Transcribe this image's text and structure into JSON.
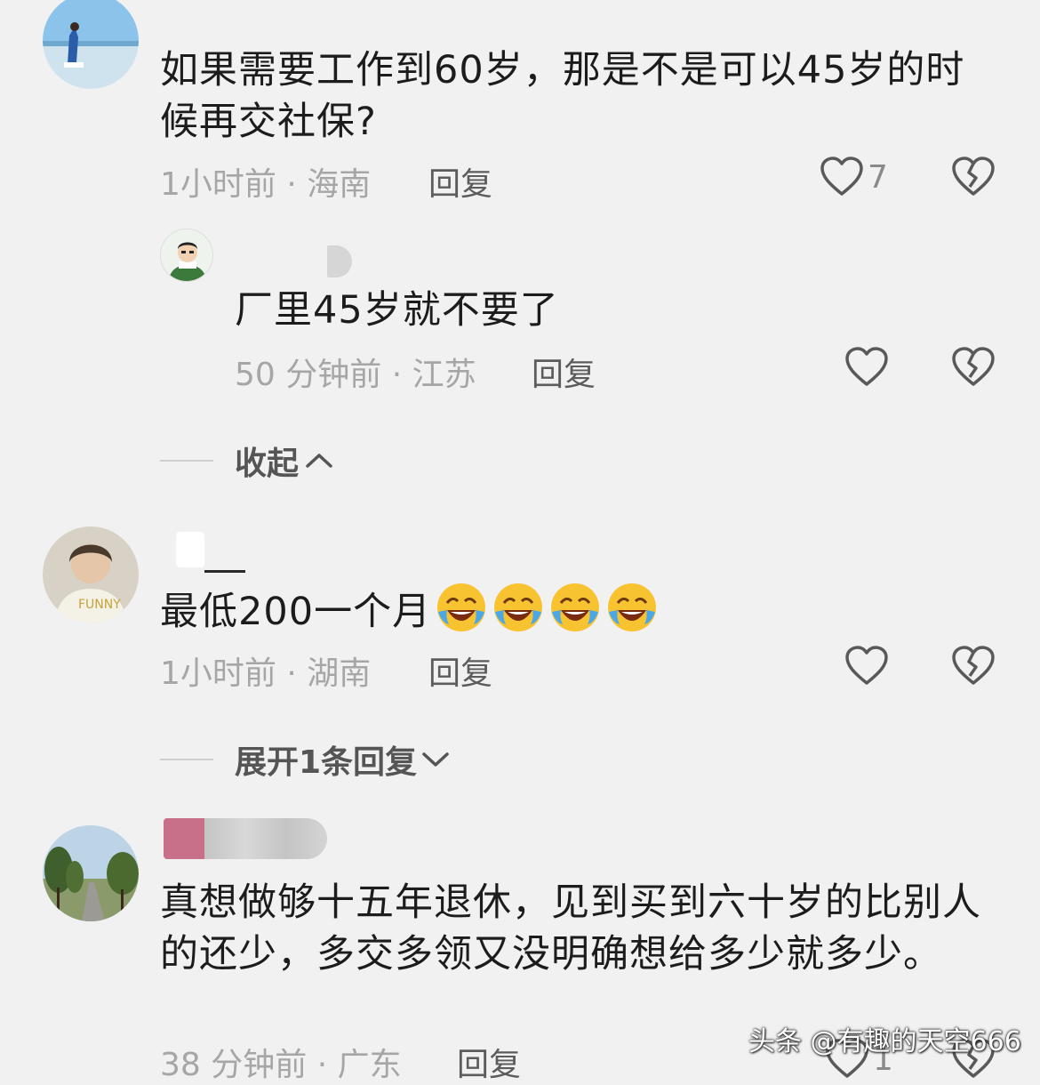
{
  "comments": [
    {
      "text": "如果需要工作到60岁，那是不是可以45岁的时候再交社保?",
      "meta": "1小时前 · 海南",
      "reply_label": "回复",
      "like_count": "7"
    },
    {
      "text": "厂里45岁就不要了",
      "meta": "50 分钟前 · 江苏",
      "reply_label": "回复",
      "like_count": ""
    },
    {
      "text": "最低200一个月",
      "meta": "1小时前 · 湖南",
      "reply_label": "回复",
      "like_count": ""
    },
    {
      "text": "真想做够十五年退休，见到买到六十岁的比别人的还少，多交多领又没明确想给多少就多少。",
      "meta": "38 分钟前 · 广东",
      "reply_label": "回复",
      "like_count": "1"
    }
  ],
  "collapse_label": "收起",
  "expand_label": "展开1条回复",
  "watermark": "头条 @有趣的天空666",
  "icons": {
    "like": "heart-outline-icon",
    "dislike": "broken-heart-icon",
    "collapse": "chevron-up-icon",
    "expand": "chevron-down-icon",
    "emoji": "rolling-on-floor-laughing-emoji"
  },
  "colors": {
    "background": "#f1f1f1",
    "text": "#1c1c1c",
    "meta": "#a6a6a6",
    "reply": "#5c5c5c"
  }
}
